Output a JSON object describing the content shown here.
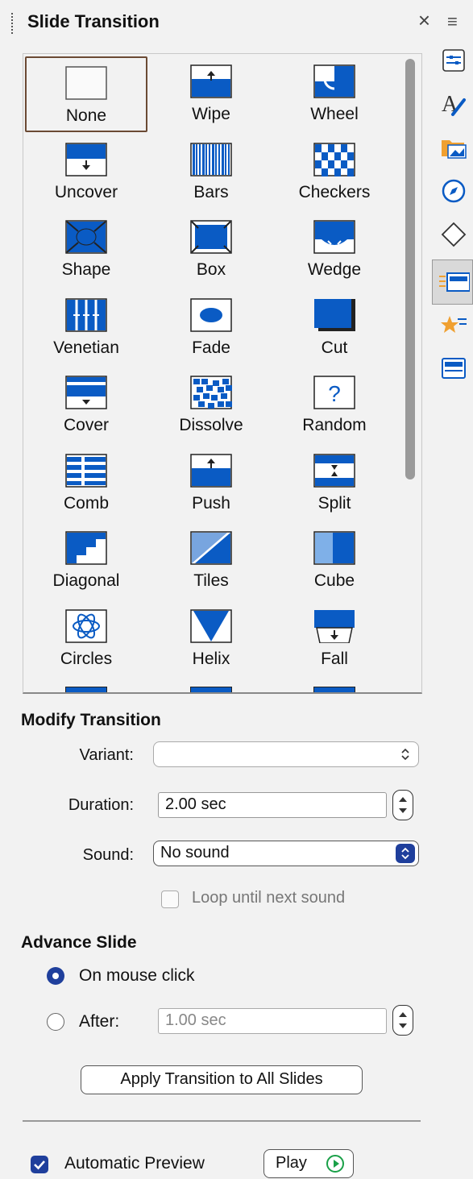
{
  "panel": {
    "title": "Slide Transition",
    "close_glyph": "×",
    "menu_glyph": "≡"
  },
  "transitions": [
    {
      "label": "None",
      "icon": "none-icon",
      "selected": true
    },
    {
      "label": "Wipe",
      "icon": "wipe-icon"
    },
    {
      "label": "Wheel",
      "icon": "wheel-icon"
    },
    {
      "label": "Uncover",
      "icon": "uncover-icon"
    },
    {
      "label": "Bars",
      "icon": "bars-icon"
    },
    {
      "label": "Checkers",
      "icon": "checkers-icon"
    },
    {
      "label": "Shape",
      "icon": "shape-icon"
    },
    {
      "label": "Box",
      "icon": "box-icon"
    },
    {
      "label": "Wedge",
      "icon": "wedge-icon"
    },
    {
      "label": "Venetian",
      "icon": "venetian-icon"
    },
    {
      "label": "Fade",
      "icon": "fade-icon"
    },
    {
      "label": "Cut",
      "icon": "cut-icon"
    },
    {
      "label": "Cover",
      "icon": "cover-icon"
    },
    {
      "label": "Dissolve",
      "icon": "dissolve-icon"
    },
    {
      "label": "Random",
      "icon": "random-icon"
    },
    {
      "label": "Comb",
      "icon": "comb-icon"
    },
    {
      "label": "Push",
      "icon": "push-icon"
    },
    {
      "label": "Split",
      "icon": "split-icon"
    },
    {
      "label": "Diagonal",
      "icon": "diagonal-icon"
    },
    {
      "label": "Tiles",
      "icon": "tiles-icon"
    },
    {
      "label": "Cube",
      "icon": "cube-icon"
    },
    {
      "label": "Circles",
      "icon": "circles-icon"
    },
    {
      "label": "Helix",
      "icon": "helix-icon"
    },
    {
      "label": "Fall",
      "icon": "fall-icon"
    }
  ],
  "modify": {
    "heading": "Modify Transition",
    "variant_label": "Variant:",
    "variant_value": "",
    "duration_label": "Duration:",
    "duration_value": "2.00 sec",
    "sound_label": "Sound:",
    "sound_value": "No sound",
    "loop_label": "Loop until next sound",
    "loop_checked": false
  },
  "advance": {
    "heading": "Advance Slide",
    "on_click_label": "On mouse click",
    "after_label": "After:",
    "after_value": "1.00 sec",
    "selected": "on_click"
  },
  "apply_all_label": "Apply Transition to All Slides",
  "footer": {
    "auto_preview_label": "Automatic Preview",
    "auto_preview_checked": true,
    "play_label": "Play"
  },
  "colors": {
    "accent": "#0a5bc4",
    "selected_border": "#6b4a34",
    "checkbox_blue": "#1f3f9c"
  },
  "sidebar_tabs": [
    "properties-icon",
    "styles-icon",
    "gallery-icon",
    "navigator-icon",
    "shapes-icon",
    "slide-transition-icon",
    "animation-icon",
    "master-slides-icon"
  ]
}
